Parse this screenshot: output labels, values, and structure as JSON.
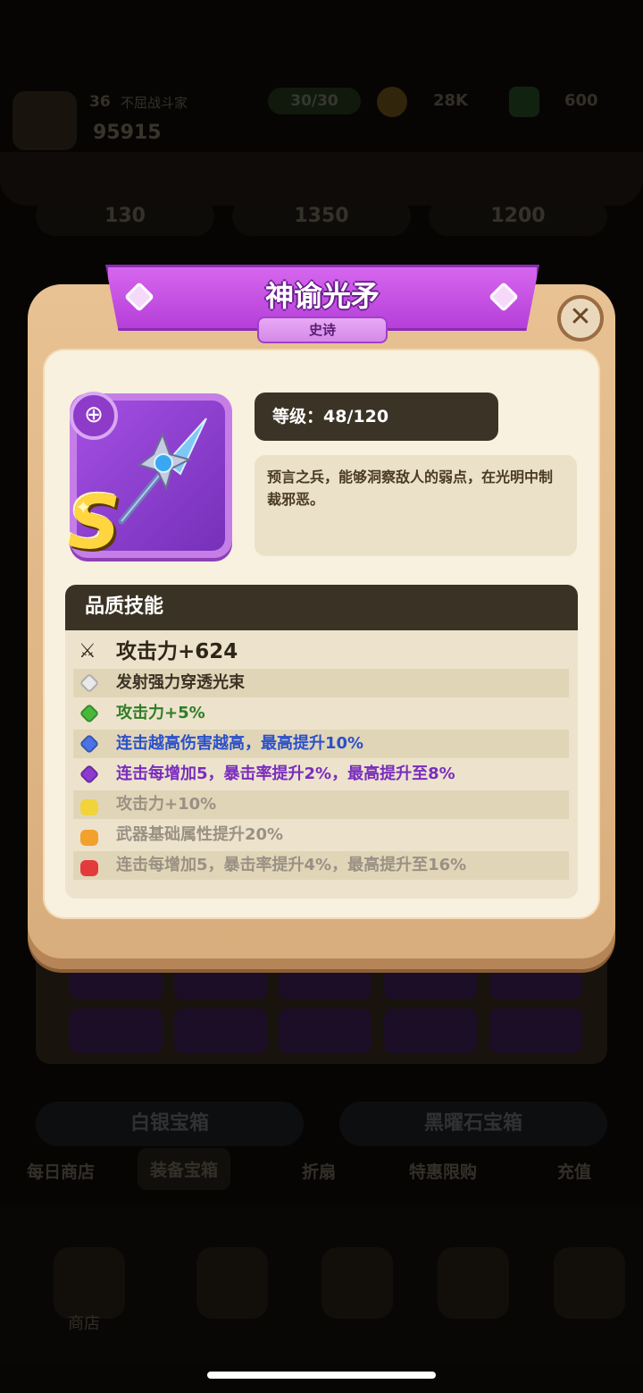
{
  "background": {
    "player_level": "36",
    "player_name": "不屈战斗家",
    "power": "95915",
    "stamina": "30/30",
    "gold": "28K",
    "gems": "600",
    "prices": [
      "130",
      "1350",
      "1200"
    ],
    "buttons": [
      "白银宝箱",
      "黑曜石宝箱"
    ],
    "tabs": [
      "每日商店",
      "装备宝箱",
      "折扇",
      "特惠限购",
      "充值"
    ],
    "active_tab": "装备宝箱",
    "home_label": "商店"
  },
  "popup": {
    "title": "神谕光矛",
    "rarity": "史诗",
    "close_icon": "close-icon",
    "grade": "S",
    "level_label": "等级：",
    "level_value": "48/120",
    "description": "预言之兵，能够洞察敌人的弱点，在光明中制裁邪恶。",
    "skills_title": "品质技能",
    "base_stat": "攻击力+624",
    "skills": [
      {
        "text": "发射强力穿透光束",
        "icon": "white-gem-icon",
        "color": "#3c3326",
        "icon_color": "#e9e9e9",
        "locked": false
      },
      {
        "text": "攻击力+5%",
        "icon": "green-gem-icon",
        "color": "#2f7d27",
        "icon_color": "#48b83b",
        "locked": false
      },
      {
        "text": "连击越高伤害越高，最高提升10%",
        "icon": "blue-gem-icon",
        "color": "#2b51c9",
        "icon_color": "#4c73e6",
        "locked": false
      },
      {
        "text": "连击每增加5，暴击率提升2%，最高提升至8%",
        "icon": "purple-gem-icon",
        "color": "#7a2dbe",
        "icon_color": "#8d3ad0",
        "locked": false
      },
      {
        "text": "攻击力+10%",
        "icon": "yellow-lock-icon",
        "color": "#9a9184",
        "icon_color": "#f0d43a",
        "locked": true
      },
      {
        "text": "武器基础属性提升20%",
        "icon": "orange-lock-icon",
        "color": "#9a9184",
        "icon_color": "#f2a12c",
        "locked": true
      },
      {
        "text": "连击每增加5，暴击率提升4%，最高提升至16%",
        "icon": "red-lock-icon",
        "color": "#9a9184",
        "icon_color": "#e33b3b",
        "locked": true
      }
    ]
  }
}
